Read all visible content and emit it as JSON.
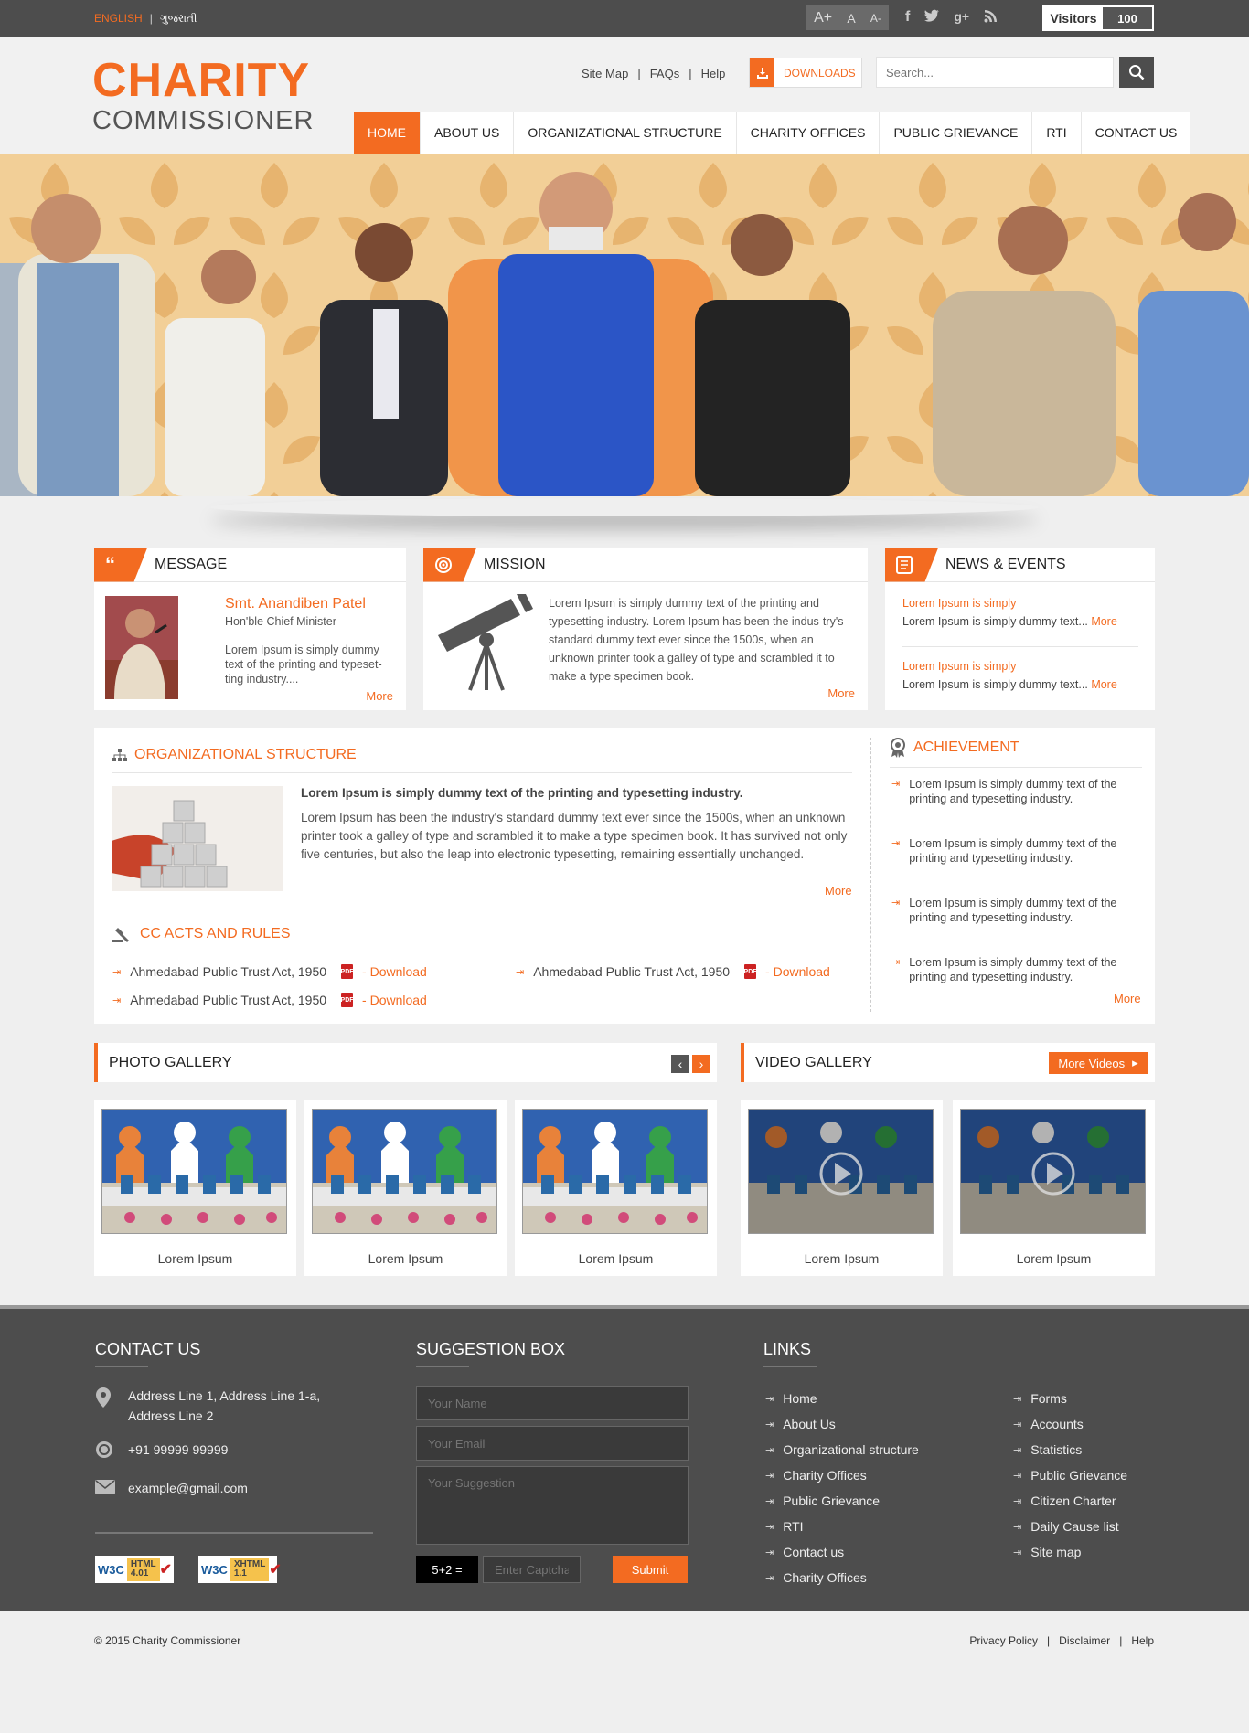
{
  "topbar": {
    "lang_en": "ENGLISH",
    "lang_gu": "ગુજરાતી",
    "font_inc": "A+",
    "font_norm": "A",
    "font_dec": "A-",
    "visitors_label": "Visitors",
    "visitors_count": "100"
  },
  "header": {
    "logo_line1": "CHARITY",
    "logo_line2": "COMMISSIONER",
    "links": [
      "Site Map",
      "FAQs",
      "Help"
    ],
    "downloads": "DOWNLOADS",
    "search_placeholder": "Search..."
  },
  "nav": [
    "HOME",
    "ABOUT US",
    "ORGANIZATIONAL STRUCTURE",
    "CHARITY OFFICES",
    "PUBLIC GRIEVANCE",
    "RTI",
    "CONTACT US"
  ],
  "message": {
    "title": "MESSAGE",
    "name": "Smt. Anandiben Patel",
    "role": "Hon'ble Chief Minister",
    "text": "Lorem Ipsum is simply dummy text of the printing and typeset-ting industry....",
    "more": "More"
  },
  "mission": {
    "title": "MISSION",
    "text": "Lorem Ipsum is simply dummy text of the printing and typesetting industry. Lorem Ipsum has been the indus-try's standard dummy text ever since the 1500s, when an unknown printer took a galley of type and scrambled it to make a type specimen book.",
    "more": "More"
  },
  "news": {
    "title": "NEWS & EVENTS",
    "items": [
      {
        "head": "Lorem Ipsum is simply",
        "text": "Lorem Ipsum is simply dummy text...",
        "more": "More"
      },
      {
        "head": "Lorem Ipsum is simply",
        "text": "Lorem Ipsum is simply dummy text...",
        "more": "More"
      }
    ]
  },
  "org": {
    "title": "ORGANIZATIONAL STRUCTURE",
    "bold": "Lorem Ipsum is simply dummy text of the printing and typesetting industry.",
    "text": "Lorem Ipsum has been the industry's standard dummy text ever since the 1500s, when an unknown printer took a galley of type and scrambled it to make a type specimen book. It has survived not only five centuries, but also the leap into electronic typesetting, remaining essentially unchanged.",
    "more": "More"
  },
  "acts": {
    "title": "CC ACTS AND RULES",
    "items": [
      {
        "name": "Ahmedabad Public Trust Act, 1950",
        "dl": "- Download"
      },
      {
        "name": "Ahmedabad Public Trust Act, 1950",
        "dl": "- Download"
      },
      {
        "name": "Ahmedabad Public Trust Act, 1950",
        "dl": "- Download"
      }
    ]
  },
  "achievement": {
    "title": "ACHIEVEMENT",
    "items": [
      "Lorem Ipsum is simply dummy text of the printing and typesetting industry.",
      "Lorem Ipsum is simply dummy text of the printing and typesetting industry.",
      "Lorem Ipsum is simply dummy text of the printing and typesetting industry.",
      "Lorem Ipsum is simply dummy text of the printing and typesetting industry."
    ],
    "more": "More"
  },
  "photo_gallery": {
    "title": "PHOTO GALLERY",
    "captions": [
      "Lorem Ipsum",
      "Lorem Ipsum",
      "Lorem Ipsum"
    ]
  },
  "video_gallery": {
    "title": "VIDEO GALLERY",
    "more_btn": "More Videos",
    "captions": [
      "Lorem Ipsum",
      "Lorem Ipsum"
    ]
  },
  "footer": {
    "contact": {
      "title": "CONTACT US",
      "address": "Address Line 1, Address Line 1-a, Address Line 2",
      "phone": "+91 99999 99999",
      "email": "example@gmail.com",
      "badge1_top": "HTML",
      "badge1_ver": "4.01",
      "badge2_top": "XHTML",
      "badge2_ver": "1.1",
      "badge_w3c": "W3C"
    },
    "suggestion": {
      "title": "SUGGESTION BOX",
      "name_ph": "Your Name",
      "email_ph": "Your Email",
      "sugg_ph": "Your Suggestion",
      "captcha": "5+2 =",
      "captcha_ph": "Enter Captcha",
      "submit": "Submit"
    },
    "links": {
      "title": "LINKS",
      "col1": [
        "Home",
        "About Us",
        "Organizational structure",
        "Charity Offices",
        "Public Grievance",
        "RTI",
        "Contact us",
        "Charity Offices"
      ],
      "col2": [
        "Forms",
        "Accounts",
        "Statistics",
        "Public Grievance",
        "Citizen Charter",
        "Daily Cause list",
        "Site map"
      ]
    }
  },
  "bottom": {
    "copyright": "© 2015 Charity Commissioner",
    "links": [
      "Privacy Policy",
      "Disclaimer",
      "Help"
    ]
  },
  "colors": {
    "accent": "#f36b21",
    "dark": "#4d4d4d"
  }
}
